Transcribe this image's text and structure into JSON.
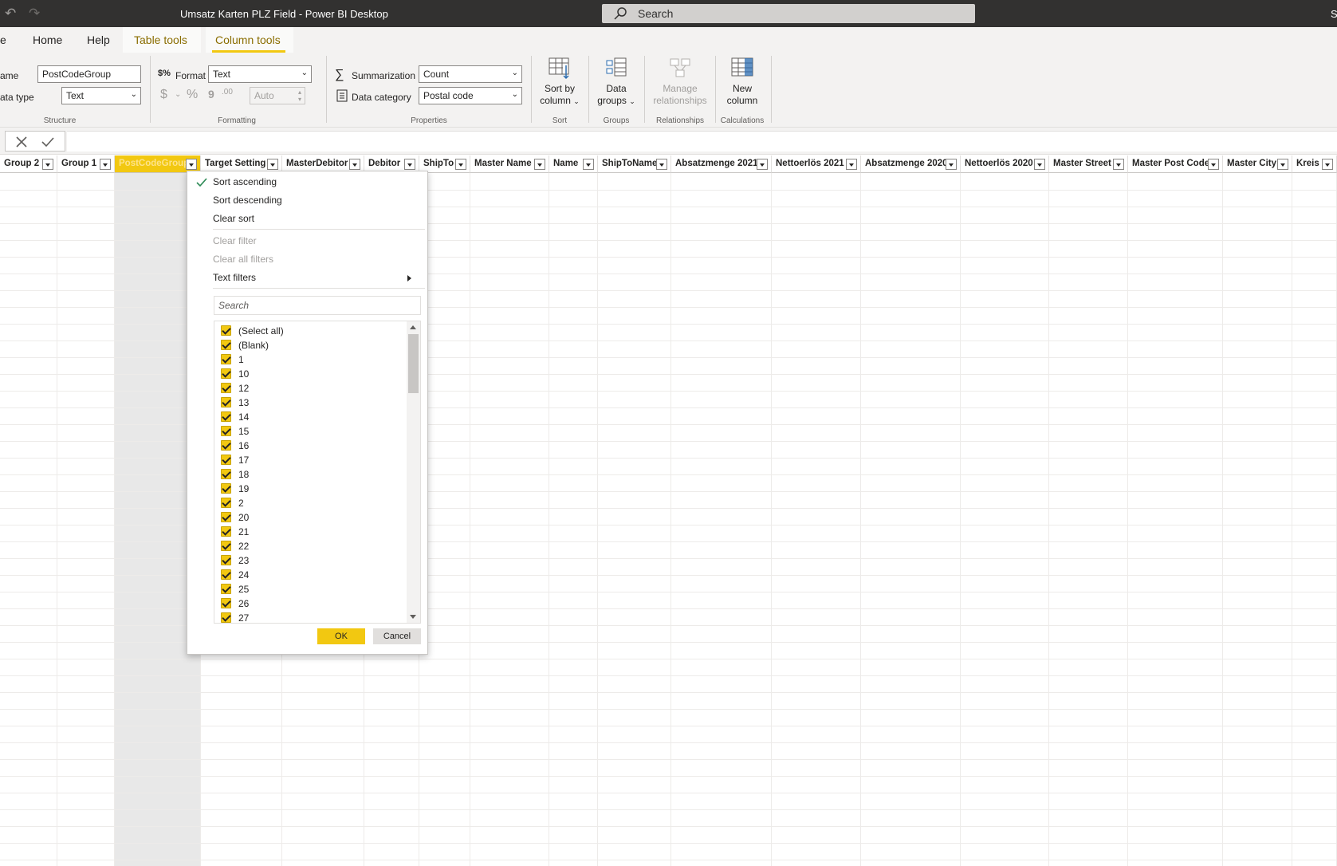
{
  "titlebar": {
    "title": "Umsatz Karten PLZ Field - Power BI Desktop",
    "search_placeholder": "Search",
    "user_char": "S"
  },
  "tabs": [
    {
      "label": "e"
    },
    {
      "label": "Home"
    },
    {
      "label": "Help"
    },
    {
      "label": "Table tools"
    },
    {
      "label": "Column tools"
    }
  ],
  "ribbon": {
    "structure": {
      "name_label": "ame",
      "name_value": "PostCodeGroup",
      "datatype_label": "ata type",
      "datatype_value": "Text",
      "group_label": "Structure"
    },
    "formatting": {
      "format_label": "Format",
      "format_value": "Text",
      "currency_symbol": "$",
      "percent_symbol": "%",
      "comma_symbol": "9",
      "decimals_symbol": ".00",
      "auto_value": "Auto",
      "group_label": "Formatting"
    },
    "properties": {
      "summarization_label": "Summarization",
      "summarization_value": "Count",
      "datacategory_label": "Data category",
      "datacategory_value": "Postal code",
      "group_label": "Properties"
    },
    "sort": {
      "button_line1": "Sort by",
      "button_line2": "column",
      "group_label": "Sort"
    },
    "groups": {
      "button_line1": "Data",
      "button_line2": "groups",
      "group_label": "Groups"
    },
    "relationships": {
      "button_line1": "Manage",
      "button_line2": "relationships",
      "group_label": "Relationships"
    },
    "calculations": {
      "button_line1": "New",
      "button_line2": "column",
      "group_label": "Calculations"
    }
  },
  "columns": [
    {
      "label": "Group 2"
    },
    {
      "label": "Group 1"
    },
    {
      "label": "PostCodeGroup"
    },
    {
      "label": "Target Setting"
    },
    {
      "label": "MasterDebitor"
    },
    {
      "label": "Debitor"
    },
    {
      "label": "ShipTo"
    },
    {
      "label": "Master Name"
    },
    {
      "label": "Name"
    },
    {
      "label": "ShipToName"
    },
    {
      "label": "Absatzmenge 2021"
    },
    {
      "label": "Nettoerlös 2021"
    },
    {
      "label": "Absatzmenge 2020"
    },
    {
      "label": "Nettoerlös 2020"
    },
    {
      "label": "Master Street"
    },
    {
      "label": "Master Post Code"
    },
    {
      "label": "Master City"
    },
    {
      "label": "Kreis"
    }
  ],
  "dropdown": {
    "sort_ascending": "Sort ascending",
    "sort_descending": "Sort descending",
    "clear_sort": "Clear sort",
    "clear_filter": "Clear filter",
    "clear_all_filters": "Clear all filters",
    "text_filters": "Text filters",
    "search_placeholder": "Search",
    "items": [
      "(Select all)",
      "(Blank)",
      "1",
      "10",
      "12",
      "13",
      "14",
      "15",
      "16",
      "17",
      "18",
      "19",
      "2",
      "20",
      "21",
      "22",
      "23",
      "24",
      "25",
      "26",
      "27"
    ],
    "ok_label": "OK",
    "cancel_label": "Cancel"
  },
  "colors": {
    "accent": "#f2c811",
    "titlebar": "#323130",
    "ribbon": "#f3f2f1"
  }
}
